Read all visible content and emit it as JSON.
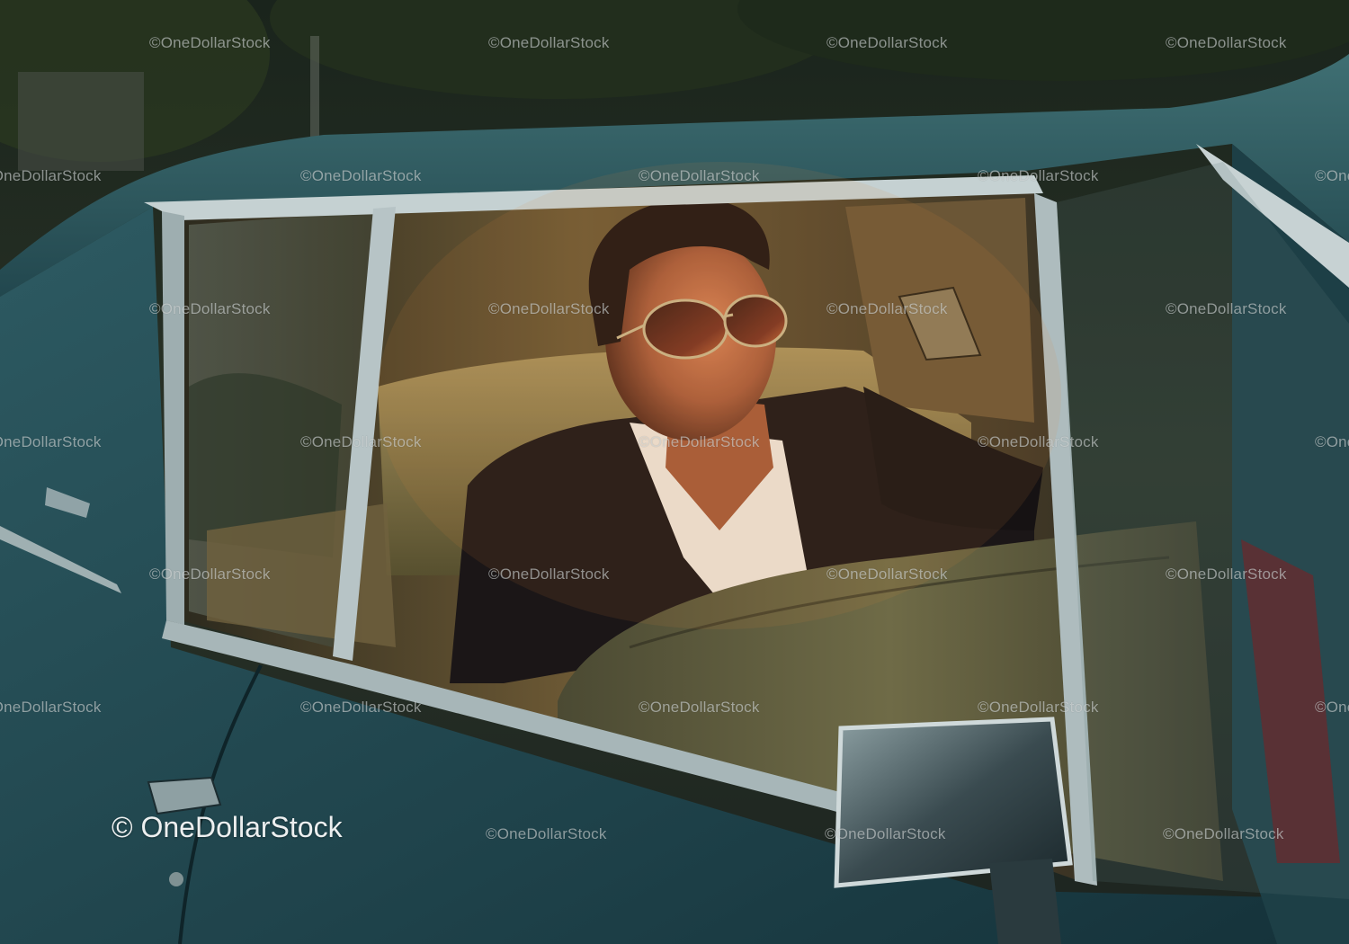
{
  "image": {
    "subject": "man-in-sunglasses-in-vintage-car",
    "colors": {
      "car_body": "#2f5e66",
      "car_body_dark": "#17333a",
      "chrome": "#b9c6c8",
      "interior_leather": "#b09b68",
      "sunset_glow": "#e0873a",
      "jacket": "#191516",
      "shirt": "#eee6dc",
      "skin": "#b86a45",
      "hair": "#1d1411"
    }
  },
  "watermark": {
    "small_text": "©OneDollarStock",
    "large_text": "© OneDollarStock"
  }
}
